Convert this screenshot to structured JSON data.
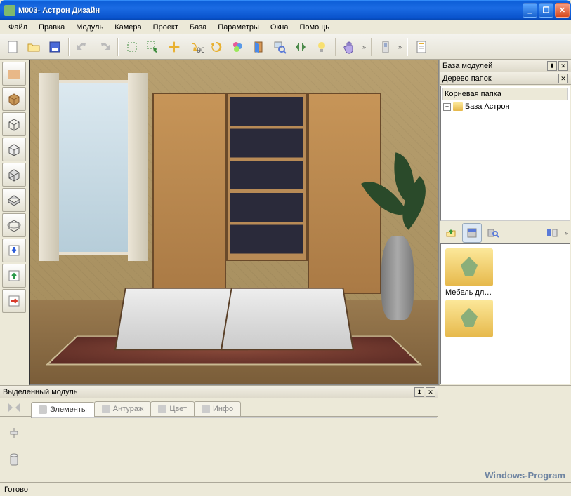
{
  "window": {
    "title": "М003- Астрон Дизайн"
  },
  "menu": [
    "Файл",
    "Правка",
    "Модуль",
    "Камера",
    "Проект",
    "База",
    "Параметры",
    "Окна",
    "Помощь"
  ],
  "toolbar_icons": [
    "new",
    "open",
    "save",
    "undo",
    "redo",
    "select-rect",
    "select-arrow",
    "move",
    "rotate90",
    "rotate",
    "flower",
    "door",
    "zoom-window",
    "mirror",
    "bulb",
    "hand",
    "phone",
    "page"
  ],
  "side_tools": [
    "texture",
    "box",
    "wireframe",
    "cube",
    "cube2",
    "extrude",
    "rotate3d",
    "import",
    "eject",
    "export"
  ],
  "panels": {
    "modules_title": "База модулей",
    "tree_title": "Дерево папок",
    "root_folder": "Корневая папка",
    "tree_items": [
      "База Астрон"
    ]
  },
  "selected_panel": {
    "title": "Выделенный модуль"
  },
  "tabs": [
    "Элементы",
    "Антураж",
    "Цвет",
    "Инфо"
  ],
  "browser": {
    "items": [
      "Мебель для д..."
    ]
  },
  "status": "Готово",
  "watermark": "Windows-Program"
}
